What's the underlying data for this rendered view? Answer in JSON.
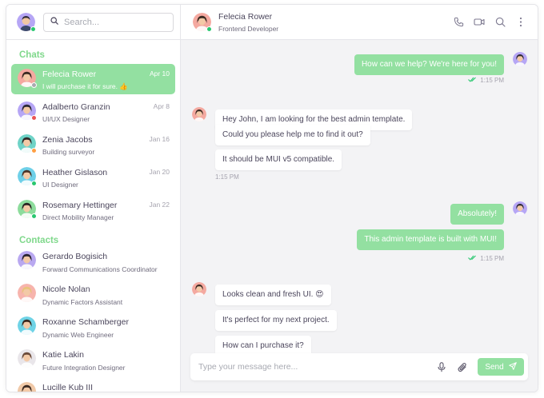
{
  "me": {
    "avatar": "avatar-me",
    "status": "online"
  },
  "search": {
    "placeholder": "Search..."
  },
  "sidebar": {
    "chats_title": "Chats",
    "contacts_title": "Contacts",
    "chats": [
      {
        "name": "Felecia Rower",
        "preview": "I will purchase it for sure. 👍",
        "date": "Apr 10",
        "status": "offline",
        "active": true,
        "avatar_color": "#f4a9a0",
        "hair": "#3b2a22"
      },
      {
        "name": "Adalberto Granzin",
        "preview": "UI/UX Designer",
        "date": "Apr 8",
        "status": "busy",
        "active": false,
        "avatar_color": "#b6a6f5",
        "hair": "#2d2a36"
      },
      {
        "name": "Zenia Jacobs",
        "preview": "Building surveyor",
        "date": "Jan 16",
        "status": "away",
        "active": false,
        "avatar_color": "#6fd3c7",
        "hair": "#2f2a28"
      },
      {
        "name": "Heather Gislason",
        "preview": "UI Designer",
        "date": "Jan 20",
        "status": "online",
        "active": false,
        "avatar_color": "#6fd0e8",
        "hair": "#4a3428"
      },
      {
        "name": "Rosemary Hettinger",
        "preview": "Direct Mobility Manager",
        "date": "Jan 22",
        "status": "online",
        "active": false,
        "avatar_color": "#8ddc9c",
        "hair": "#2b2523"
      }
    ],
    "contacts": [
      {
        "name": "Gerardo Bogisich",
        "role": "Forward Communications Coordinator",
        "avatar_color": "#b9a8f0",
        "hair": "#2a2430"
      },
      {
        "name": "Nicole Nolan",
        "role": "Dynamic Factors Assistant",
        "avatar_color": "#f7b4ad",
        "hair": "#e8c37a"
      },
      {
        "name": "Roxanne Schamberger",
        "role": "Dynamic Web Engineer",
        "avatar_color": "#6fd3e6",
        "hair": "#3a2a20"
      },
      {
        "name": "Katie Lakin",
        "role": "Future Integration Designer",
        "avatar_color": "#e9e6ea",
        "hair": "#6b4b3a"
      },
      {
        "name": "Lucille Kub III",
        "role": "",
        "avatar_color": "#f0c9a8",
        "hair": "#3b2a22"
      }
    ]
  },
  "header": {
    "name": "Felecia Rower",
    "role": "Frontend Developer",
    "status": "online"
  },
  "messages": {
    "m1": "How can we help? We're here for you!",
    "t1": "1:15 PM",
    "m2": "Hey John, I am looking for the best admin template.",
    "m3": "Could you please help me to find it out?",
    "m4": "It should be MUI v5 compatible.",
    "t2": "1:15 PM",
    "m5": "Absolutely!",
    "m6": "This admin template is built with MUI!",
    "t3": "1:15 PM",
    "m7": "Looks clean and fresh UI. 😍",
    "m8": "It's perfect for my next project.",
    "m9": "How can I purchase it?"
  },
  "composer": {
    "placeholder": "Type your message here...",
    "send_label": "Send"
  },
  "colors": {
    "accent": "#93e0a1",
    "accent_text": "#7fd88b",
    "online": "#28c76f",
    "busy": "#ea5455",
    "away": "#ff9f43",
    "offline": "#a8aaae"
  },
  "icons": [
    "search-icon",
    "phone-icon",
    "video-icon",
    "search-icon",
    "more-vertical-icon",
    "double-check-icon",
    "microphone-icon",
    "paperclip-icon",
    "send-icon"
  ]
}
